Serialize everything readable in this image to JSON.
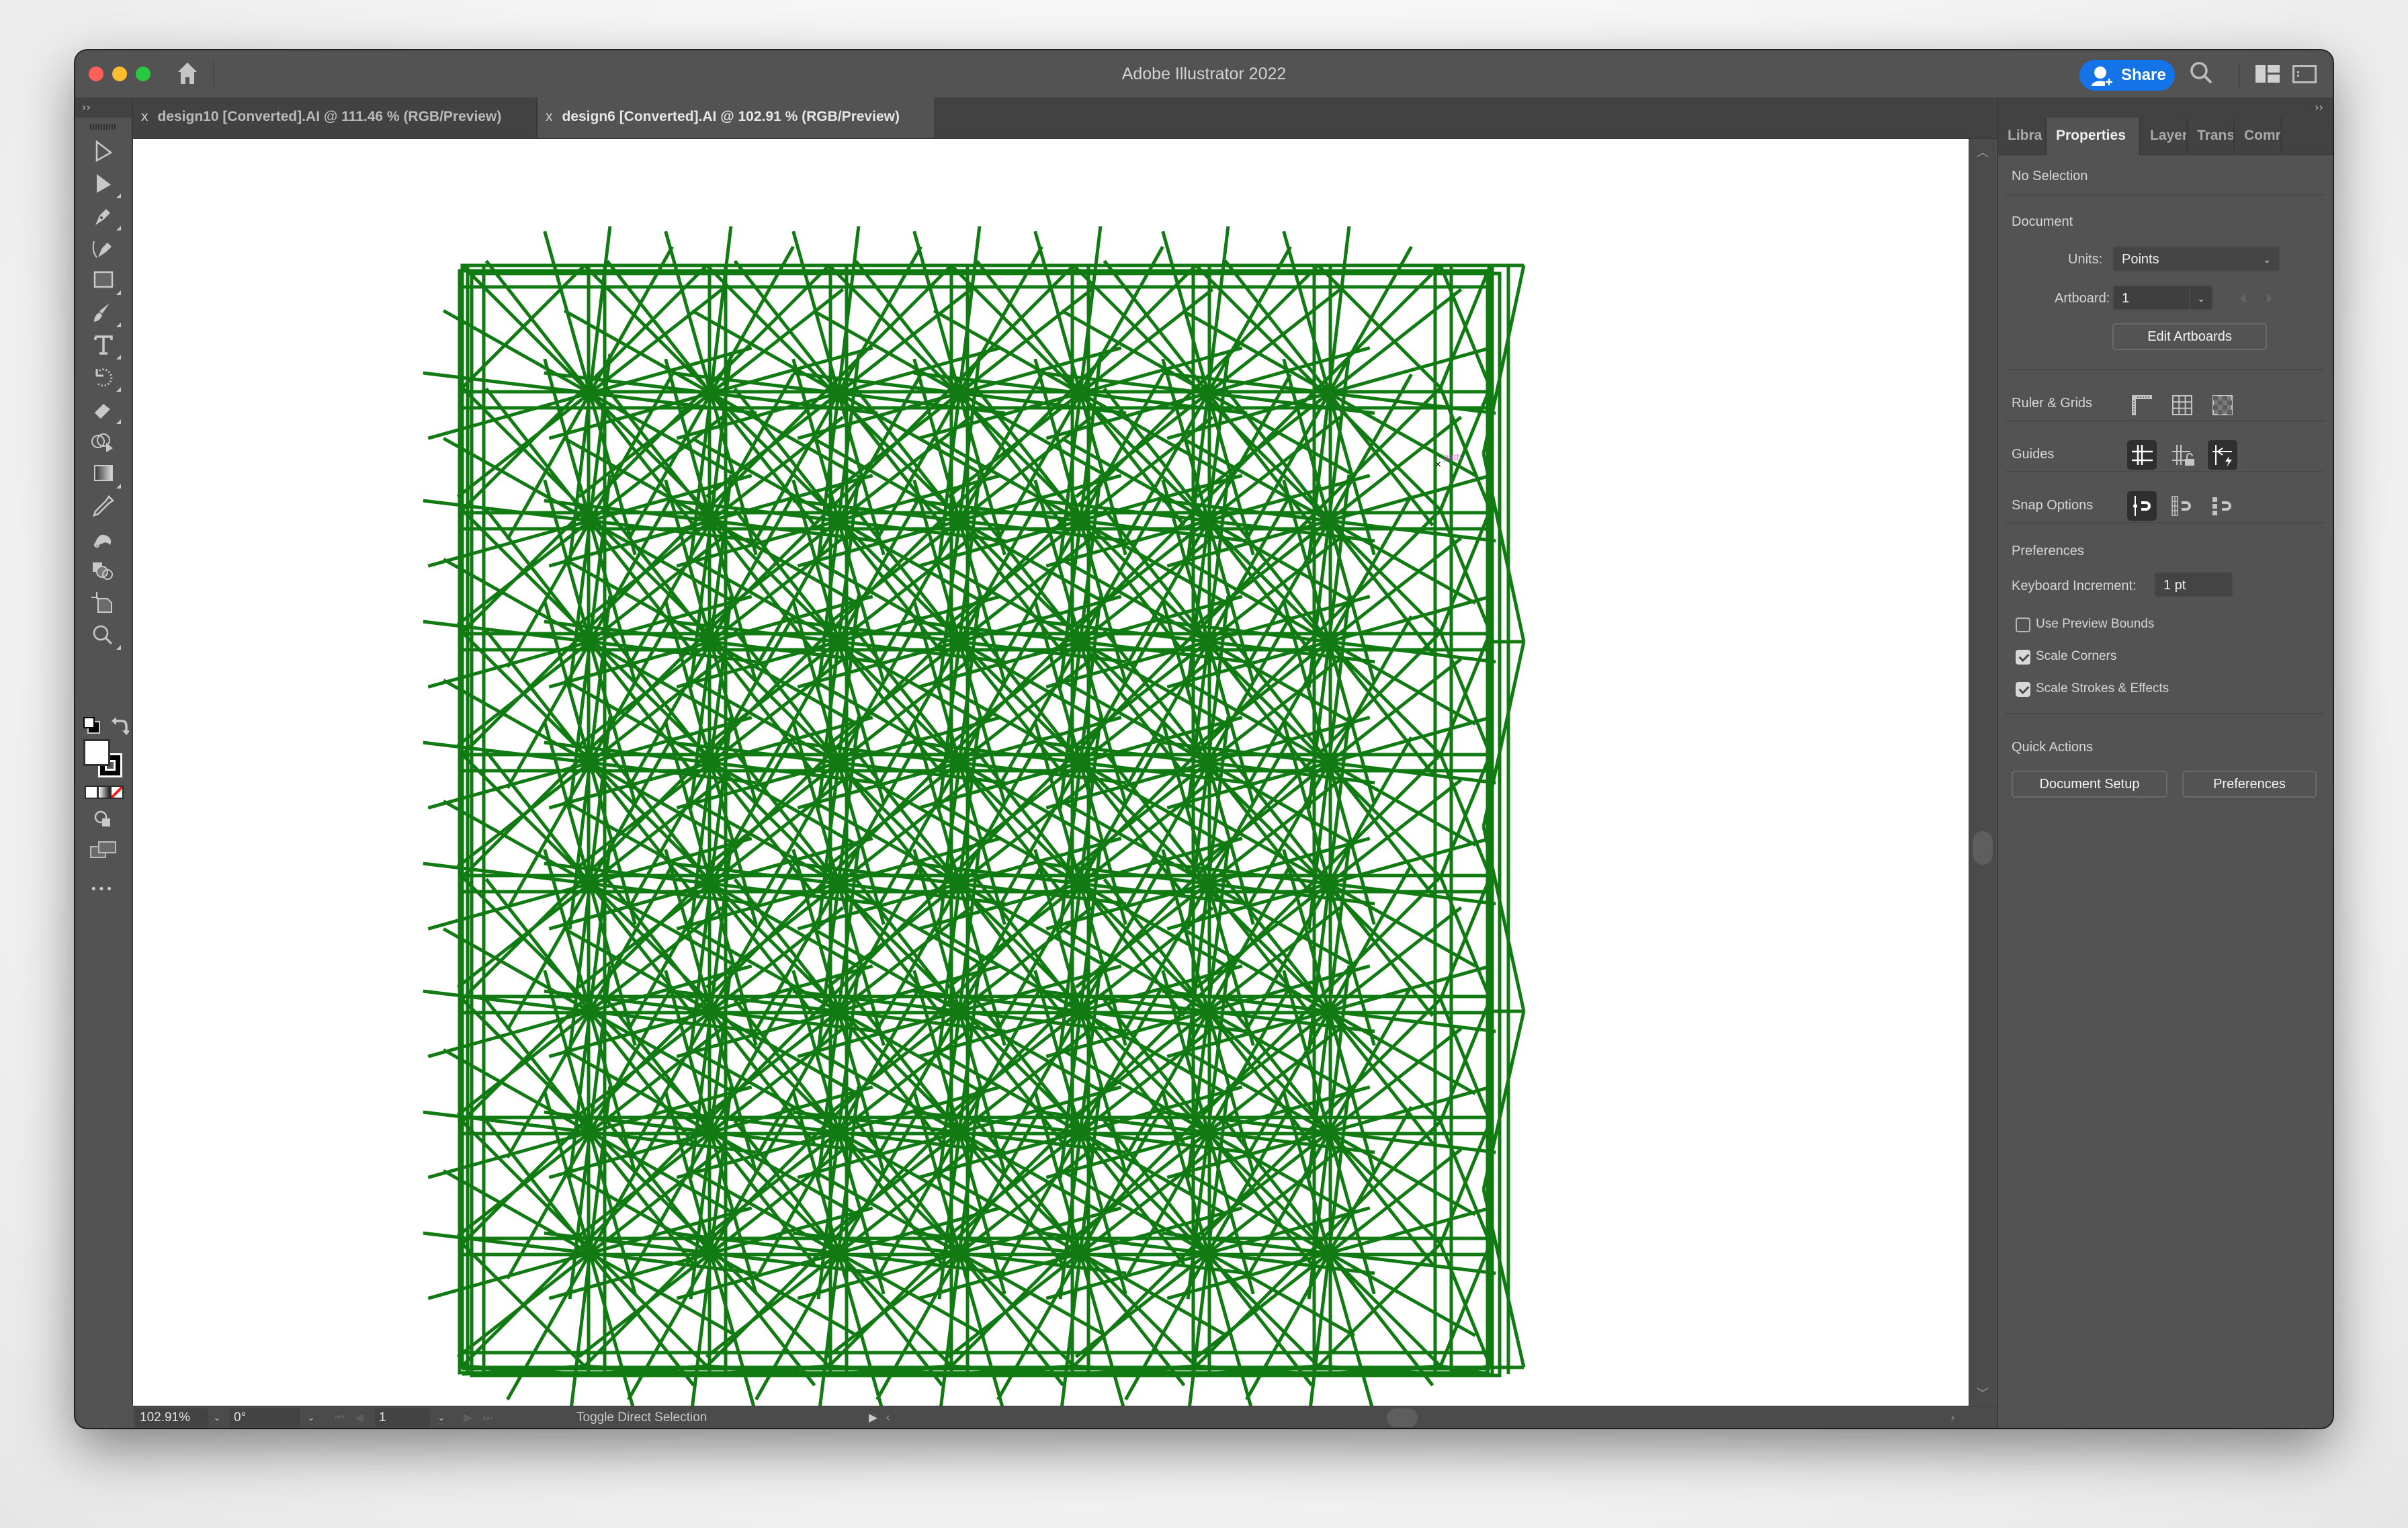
{
  "window": {
    "app_title": "Adobe Illustrator 2022",
    "share_label": "Share"
  },
  "documents": {
    "tabs": [
      {
        "label": "design10 [Converted].AI @ 111.46 % (RGB/Preview)",
        "active": false,
        "close": "x"
      },
      {
        "label": "design6 [Converted].AI @ 102.91 % (RGB/Preview)",
        "active": true,
        "close": "x"
      }
    ]
  },
  "toolbar": {
    "collapse": "››",
    "tools": [
      "selection-tool",
      "direct-selection-tool",
      "pen-tool",
      "curvature-tool",
      "rectangle-tool",
      "paintbrush-tool",
      "type-tool",
      "rotate-tool",
      "eraser-tool",
      "shape-builder-tool",
      "gradient-tool",
      "eyedropper-tool",
      "puppet-warp-tool",
      "blend-tool",
      "artboard-tool",
      "zoom-tool"
    ],
    "fill_color": "#ffffff",
    "stroke_color": "#000000",
    "more": "•••"
  },
  "canvas": {
    "smart_guide_label": "path",
    "artwork": {
      "stroke_color": "#117a12",
      "description": "Repeating geometric line pattern of radiating lines, squares and diagonals"
    }
  },
  "statusbar": {
    "zoom": "102.91%",
    "rotation": "0°",
    "artboard": "1",
    "status_text": "Toggle Direct Selection"
  },
  "panel": {
    "collapse": "››",
    "tabs": [
      {
        "label": "Libra",
        "active": false
      },
      {
        "label": "Properties",
        "active": true
      },
      {
        "label": "Layer",
        "active": false
      },
      {
        "label": "Trans",
        "active": false
      },
      {
        "label": "Comr",
        "active": false
      }
    ],
    "selection_status": "No Selection",
    "document": {
      "heading": "Document",
      "units_label": "Units:",
      "units_value": "Points",
      "artboard_label": "Artboard:",
      "artboard_value": "1",
      "edit_artboards": "Edit Artboards"
    },
    "ruler_grids": {
      "label": "Ruler & Grids"
    },
    "guides": {
      "label": "Guides"
    },
    "snap": {
      "label": "Snap Options"
    },
    "preferences": {
      "heading": "Preferences",
      "keyboard_increment_label": "Keyboard Increment:",
      "keyboard_increment_value": "1 pt",
      "checkboxes": [
        {
          "label": "Use Preview Bounds",
          "checked": false
        },
        {
          "label": "Scale Corners",
          "checked": true
        },
        {
          "label": "Scale Strokes & Effects",
          "checked": true
        }
      ]
    },
    "quick_actions": {
      "heading": "Quick Actions",
      "document_setup": "Document Setup",
      "preferences": "Preferences"
    }
  }
}
